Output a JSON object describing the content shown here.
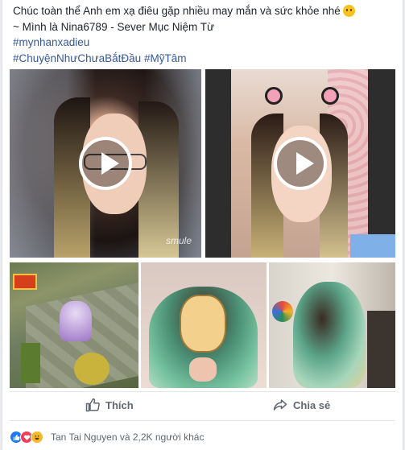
{
  "post": {
    "lines": [
      "Chúc toàn thể Anh em xạ điêu gặp nhiều may mắn và sức khỏe nhé",
      "~ Mình là Nina6789 - Sever Mục Niệm Từ"
    ],
    "hashtags": [
      "#mynhanxadieu",
      "#ChuyệnNhưChưaBắtĐầu",
      "#MỹTâm"
    ]
  },
  "media": {
    "video1_watermark": "smule"
  },
  "actions": {
    "like_label": "Thích",
    "share_label": "Chia sẻ"
  },
  "reactions": {
    "icons": [
      "like-icon",
      "love-icon",
      "haha-icon"
    ],
    "summary": "Tan Tai Nguyen và 2,2K người khác"
  },
  "colors": {
    "link": "#365899",
    "muted": "#606770",
    "like_blue": "#2078f4",
    "love_red": "#f33e58",
    "haha_yellow": "#f7b928"
  }
}
